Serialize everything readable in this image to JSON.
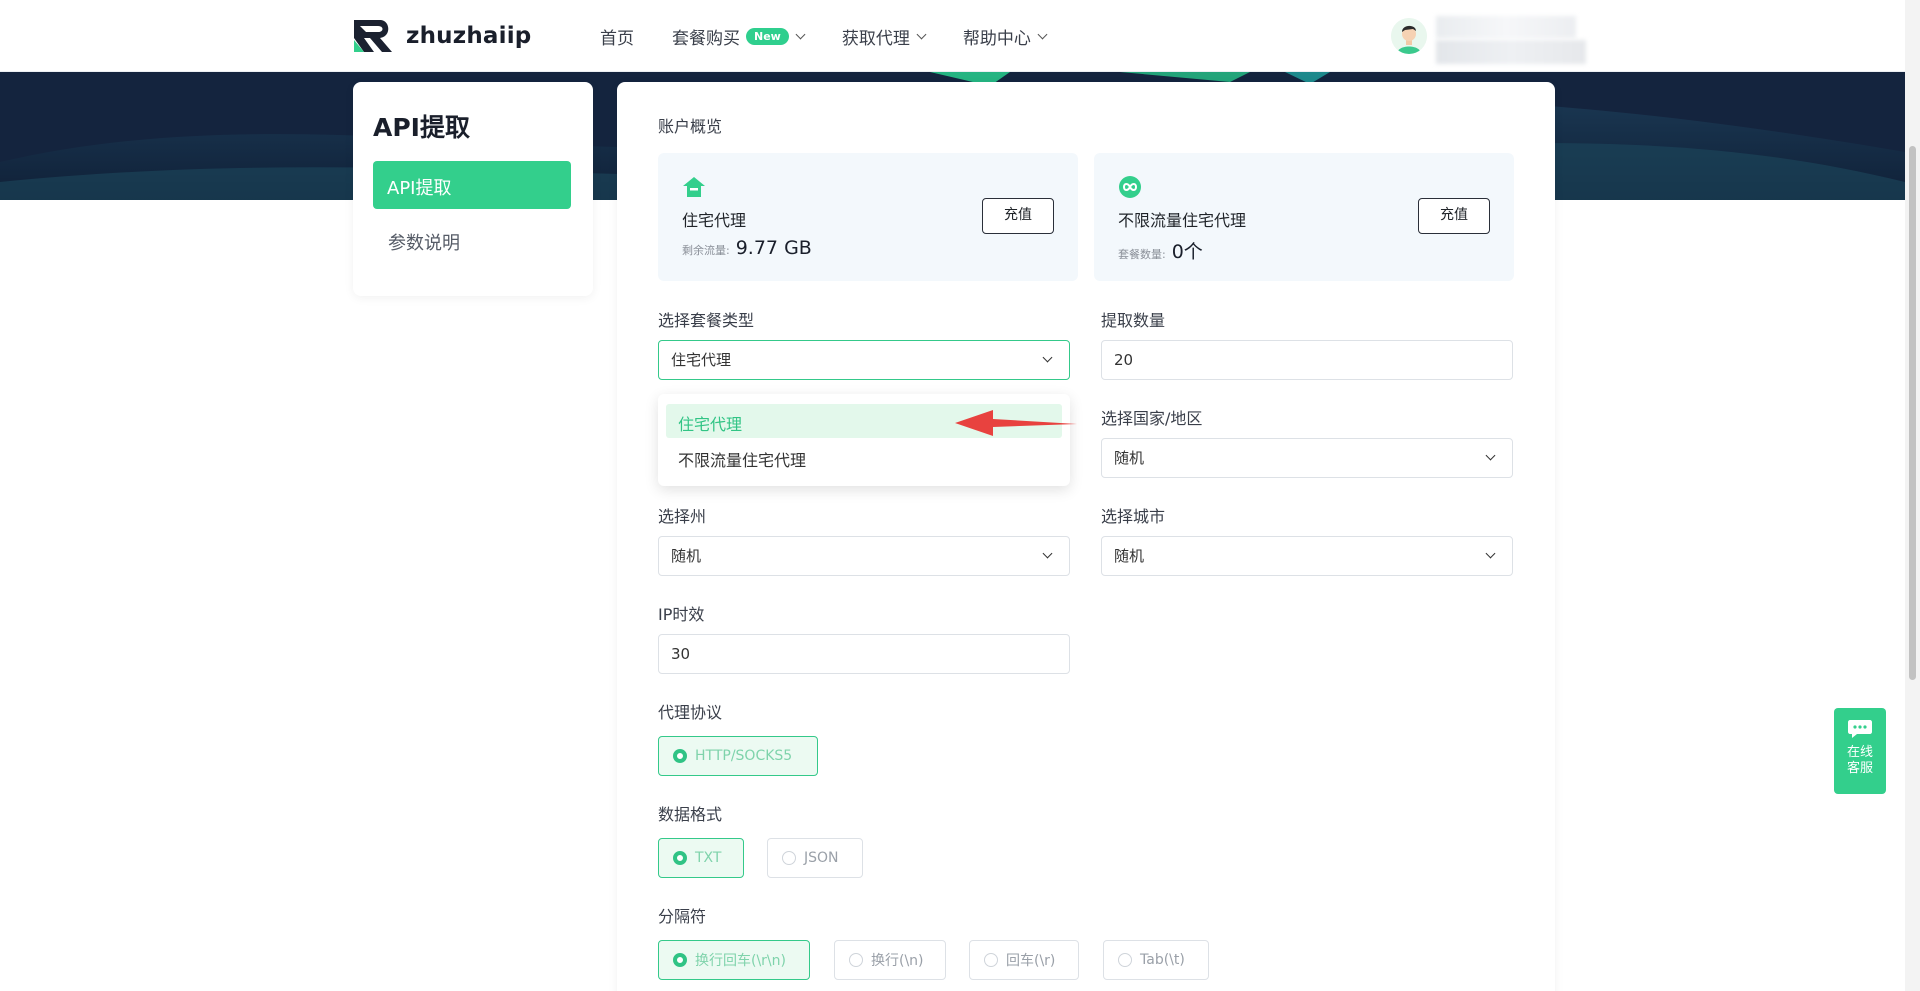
{
  "header": {
    "logo_text": "zhuzhaiip",
    "nav": [
      {
        "label": "首页",
        "has_dropdown": false
      },
      {
        "label": "套餐购买",
        "badge": "New",
        "has_dropdown": true
      },
      {
        "label": "获取代理",
        "has_dropdown": true
      },
      {
        "label": "帮助中心",
        "has_dropdown": true
      }
    ]
  },
  "sidebar": {
    "title": "API提取",
    "items": [
      {
        "label": "API提取",
        "active": true
      },
      {
        "label": "参数说明",
        "active": false
      }
    ]
  },
  "overview": {
    "title": "账户概览",
    "cards": [
      {
        "name": "住宅代理",
        "sub_label": "剩余流量:",
        "value": "9.77 GB",
        "button": "充值",
        "icon": "home-icon"
      },
      {
        "name": "不限流量住宅代理",
        "sub_label": "套餐数量:",
        "value": "0个",
        "button": "充值",
        "icon": "infinity-icon"
      }
    ]
  },
  "form": {
    "package_type": {
      "label": "选择套餐类型",
      "value": "住宅代理",
      "options": [
        "住宅代理",
        "不限流量住宅代理"
      ]
    },
    "quantity": {
      "label": "提取数量",
      "value": "20"
    },
    "country": {
      "label": "选择国家/地区",
      "value": "随机"
    },
    "state": {
      "label": "选择州",
      "value": "随机"
    },
    "city": {
      "label": "选择城市",
      "value": "随机"
    },
    "ip_duration": {
      "label": "IP时效",
      "value": "30"
    },
    "protocol": {
      "label": "代理协议",
      "options": [
        "HTTP/SOCKS5"
      ],
      "selected": "HTTP/SOCKS5"
    },
    "format": {
      "label": "数据格式",
      "options": [
        "TXT",
        "JSON"
      ],
      "selected": "TXT"
    },
    "separator": {
      "label": "分隔符",
      "options": [
        "换行回车(\\r\\n)",
        "换行(\\n)",
        "回车(\\r)",
        "Tab(\\t)"
      ],
      "selected": "换行回车(\\r\\n)"
    }
  },
  "chat_widget": {
    "line1": "在线",
    "line2": "客服"
  },
  "colors": {
    "accent": "#33cf8c",
    "hero": "#14243e",
    "arrow": "#e8423f"
  }
}
